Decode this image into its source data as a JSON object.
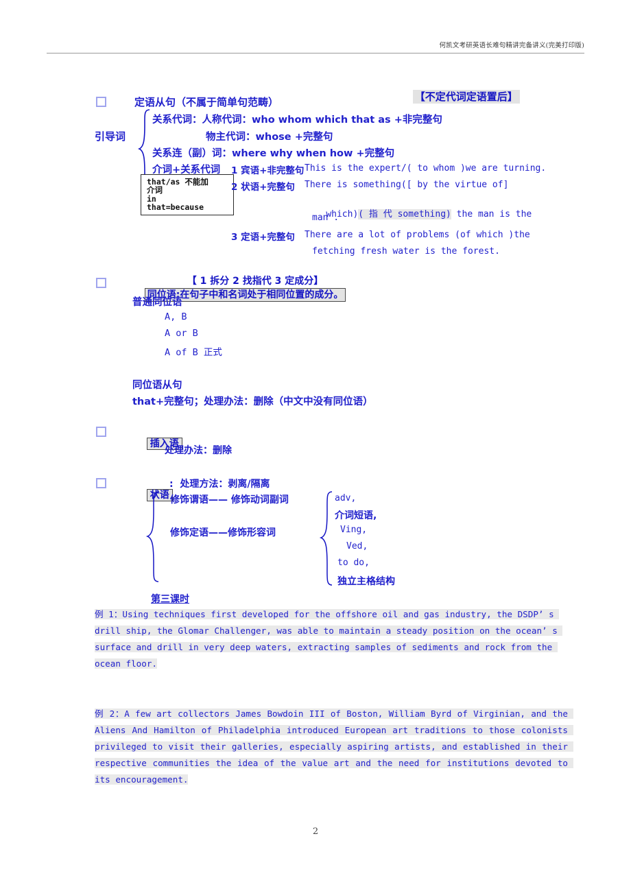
{
  "header": {
    "title": "何凯文考研英语长难句精讲完备讲义(完美打印版)"
  },
  "banners": {
    "indef_pronoun": "【不定代词定语置后】",
    "three_steps": "【 1 拆分 2 找指代 3 定成分】"
  },
  "sections": {
    "attributive_clause": {
      "heading": "定语从句（不属于简单句范畴）",
      "guide_label": "引导词",
      "lines": {
        "rel_pronoun": "关系代词：人称代词：who whom which that as +非完整句",
        "possessive": "物主代词：whose +完整句",
        "rel_adverb": "关系连（副）词：where why when how +完整句",
        "prep_rel": "介词+关系代词",
        "item1_label": "1 宾语+非完整句",
        "item1_text": "This is the expert/( to whom )we are turning.",
        "item2_label": "2 状语+完整句",
        "item2_text_a": "There is something([ by the virtue of]",
        "item2_text_b": "which)",
        "item2_text_b_hl": "( 指 代 something)",
        "item2_text_b_rest": " the man is the",
        "item2_text_c": "man .",
        "item3_label": "3 定语+完整句",
        "item3_text_a": "There are a lot of problems (of which )the",
        "item3_text_b": "fetching fresh water is the forest."
      },
      "note_box": [
        "that/as 不能加",
        "介词",
        "in",
        "that=because"
      ]
    },
    "appositive": {
      "heading": "同位语:在句子中和名词处于相同位置的成分。",
      "ordinary_label": "普通同位语",
      "forms": [
        "A, B",
        "A or B",
        "A of B 正式"
      ],
      "clause_label": "同位语从句",
      "clause_rule": "that+完整句；处理办法：删除（中文中没有同位语）"
    },
    "parenthesis": {
      "heading": "插入语",
      "method": "处理办法：删除"
    },
    "adverbial": {
      "heading": "状语",
      "method": ":  处理方法：剥离/隔离",
      "left_items": [
        "修饰谓语—— 修饰动词副词",
        "修饰定语——修饰形容词"
      ],
      "right_items": [
        "adv,",
        "介词短语,",
        "Ving,",
        "Ved,",
        "to do,",
        "独立主格结构"
      ]
    },
    "lesson_three": "第三课时"
  },
  "examples": [
    {
      "label": "例 1：",
      "text": "Using techniques first developed for the offshore oil and gas industry, the DSDP’ s drill ship, the Glomar Challenger, was able to maintain a steady position on the ocean’ s surface and drill in very deep waters, extracting samples of sediments and rock from the ocean floor."
    },
    {
      "label": "例 2：",
      "text": "A few art collectors James Bowdoin III of Boston, William Byrd of Virginian, and the Aliens And Hamilton of Philadelphia introduced European art traditions to those colonists privileged to visit their galleries, especially aspiring artists, and established in their respective communities the idea of the value art and the need for institutions devoted to its encouragement."
    }
  ],
  "footer": {
    "page_number": "2"
  },
  "colors": {
    "text_blue": "#2222cc",
    "highlight_gray": "#e3e3e3",
    "checkbox_border": "#9fa4ee"
  }
}
